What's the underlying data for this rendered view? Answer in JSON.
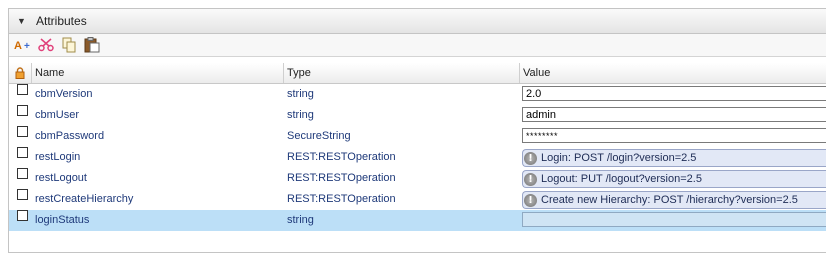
{
  "panel": {
    "title": "Attributes"
  },
  "toolbar": {
    "items": [
      {
        "name": "add-attribute-button",
        "icon": "add-attribute-icon"
      },
      {
        "name": "cut-button",
        "icon": "scissors-icon"
      },
      {
        "name": "copy-button",
        "icon": "copy-icon"
      },
      {
        "name": "paste-button",
        "icon": "paste-icon"
      }
    ]
  },
  "table": {
    "headers": {
      "lock": "lock-icon",
      "name": "Name",
      "type": "Type",
      "value": "Value"
    },
    "rows": [
      {
        "name": "cbmVersion",
        "type": "string",
        "value": "2.0",
        "kind": "input"
      },
      {
        "name": "cbmUser",
        "type": "string",
        "value": "admin",
        "kind": "input"
      },
      {
        "name": "cbmPassword",
        "type": "SecureString",
        "value": "********",
        "kind": "password"
      },
      {
        "name": "restLogin",
        "type": "REST:RESTOperation",
        "value": "Login: POST /login?version=2.5",
        "kind": "operation"
      },
      {
        "name": "restLogout",
        "type": "REST:RESTOperation",
        "value": "Logout: PUT /logout?version=2.5",
        "kind": "operation"
      },
      {
        "name": "restCreateHierarchy",
        "type": "REST:RESTOperation",
        "value": "Create new Hierarchy: POST /hierarchy?version=2.5",
        "kind": "operation"
      },
      {
        "name": "loginStatus",
        "type": "string",
        "value": "",
        "kind": "empty",
        "selected": true
      }
    ]
  },
  "colors": {
    "selected_row": "#bcdff7",
    "operation_bg": "#e2e8f6",
    "link_text": "#1f3a7a"
  }
}
